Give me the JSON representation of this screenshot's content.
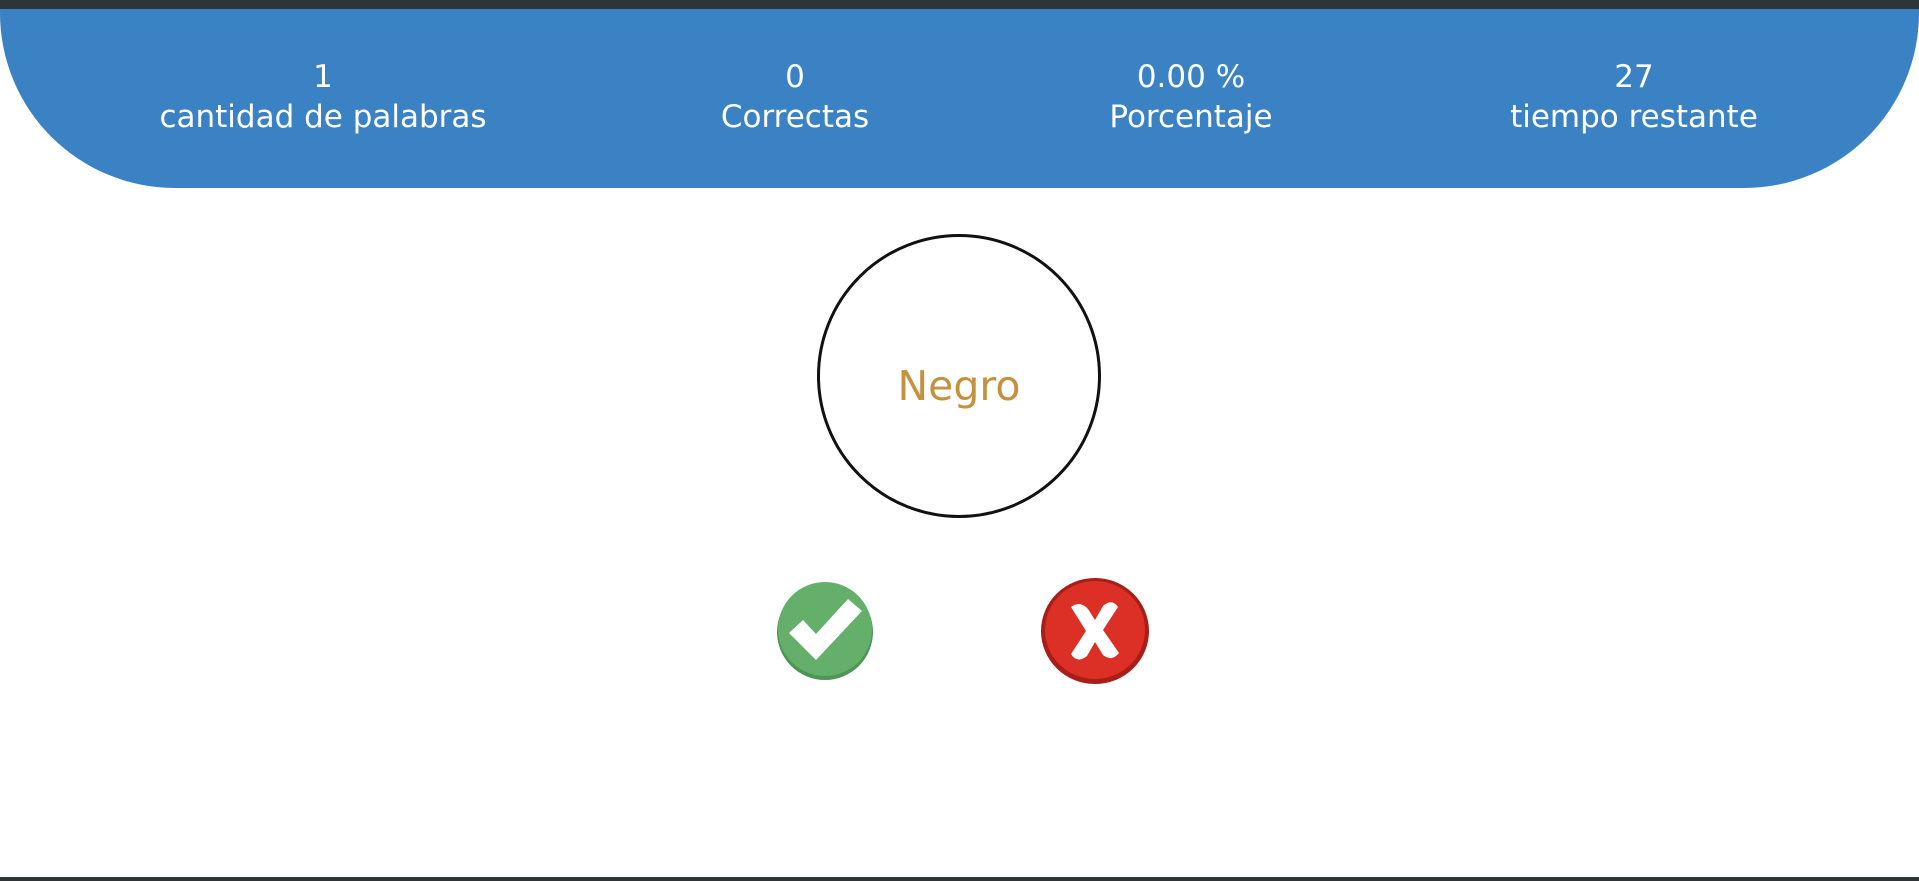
{
  "stats": {
    "words": {
      "value": "1",
      "label": "cantidad de palabras"
    },
    "correct": {
      "value": "0",
      "label": "Correctas"
    },
    "percent": {
      "value": "0.00 %",
      "label": "Porcentaje"
    },
    "time": {
      "value": "27",
      "label": "tiempo restante"
    }
  },
  "word": {
    "text": "Negro",
    "color": "#c4913f"
  },
  "buttons": {
    "yes": {
      "icon": "check-icon",
      "color": "#64b06a"
    },
    "no": {
      "icon": "x-icon",
      "color": "#dc2f25"
    }
  },
  "colors": {
    "header": "#3a82c4",
    "frame": "#2f3437"
  }
}
